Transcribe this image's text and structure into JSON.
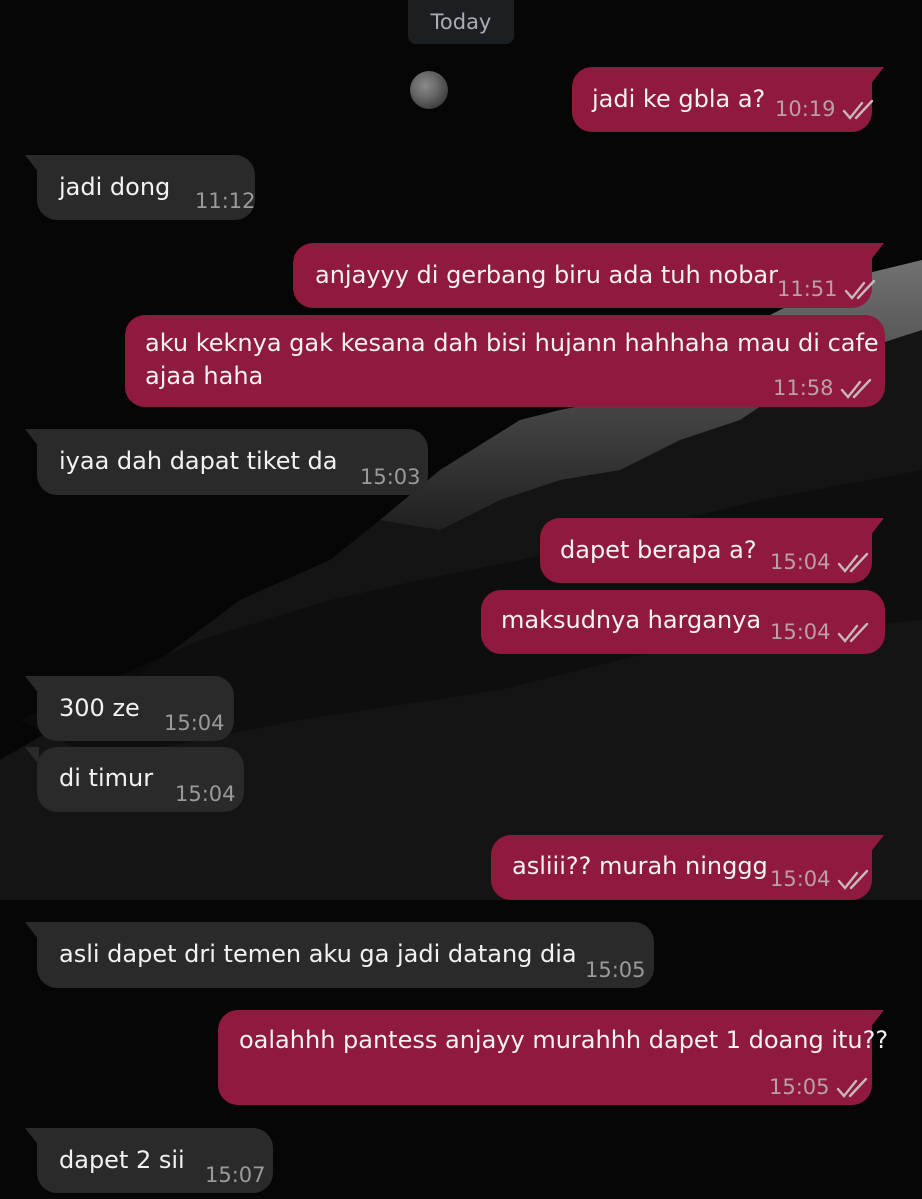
{
  "date_label": "Today",
  "colors": {
    "outgoing": "#8f1a3e",
    "incoming": "#2a2a2b",
    "background": "#060606"
  },
  "messages": [
    {
      "dir": "out",
      "text": "jadi ke gbla a?",
      "time": "10:19",
      "status": "read"
    },
    {
      "dir": "in",
      "text": "jadi dong",
      "time": "11:12"
    },
    {
      "dir": "out",
      "text": "anjayyy di gerbang biru ada tuh nobar",
      "time": "11:51",
      "status": "read"
    },
    {
      "dir": "out",
      "text": "aku keknya gak kesana dah bisi hujann hahhaha mau di cafe",
      "text2": "ajaa haha",
      "time": "11:58",
      "status": "read"
    },
    {
      "dir": "in",
      "text": "iyaa dah dapat tiket da",
      "time": "15:03"
    },
    {
      "dir": "out",
      "text": "dapet berapa a?",
      "time": "15:04",
      "status": "read"
    },
    {
      "dir": "out",
      "text": "maksudnya harganya",
      "time": "15:04",
      "status": "read"
    },
    {
      "dir": "in",
      "text": "300 ze",
      "time": "15:04"
    },
    {
      "dir": "in",
      "text": "di timur",
      "time": "15:04"
    },
    {
      "dir": "out",
      "text": "asliii?? murah ninggg",
      "time": "15:04",
      "status": "read"
    },
    {
      "dir": "in",
      "text": "asli dapet dri temen aku ga jadi datang dia",
      "time": "15:05"
    },
    {
      "dir": "out",
      "text": "oalahhh pantess anjayy murahhh dapet 1 doang itu??",
      "time": "15:05",
      "status": "read"
    },
    {
      "dir": "in",
      "text": "dapet 2 sii",
      "time": "15:07"
    }
  ]
}
